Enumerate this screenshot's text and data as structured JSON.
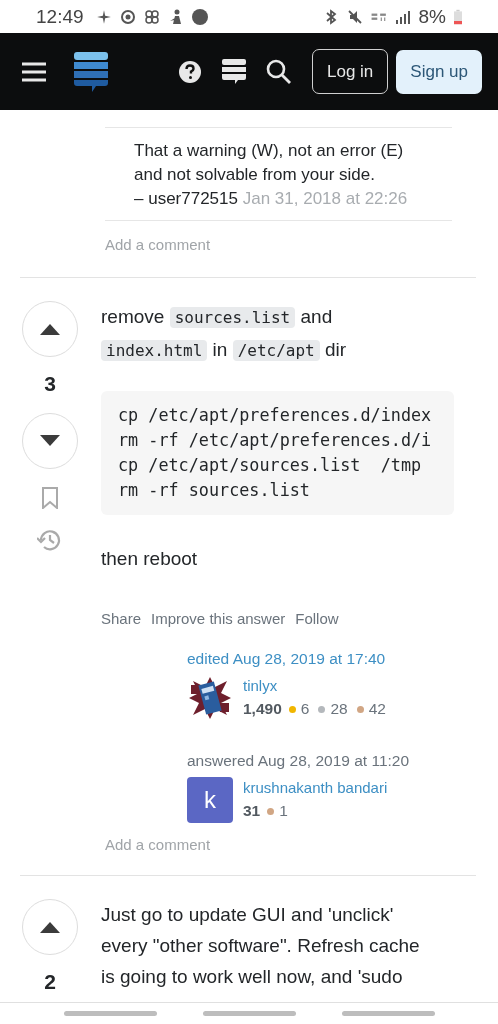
{
  "status_bar": {
    "time": "12:49",
    "battery": "8%"
  },
  "top_bar": {
    "buttons": [
      {
        "label": "Log in",
        "kind": "outline"
      },
      {
        "label": "Sign up",
        "kind": "filled"
      }
    ]
  },
  "comment": {
    "text": "That a warning (W), not an error (E) and not solvable from your side.",
    "author": "– user772515",
    "date": "Jan 31, 2018 at 22:26"
  },
  "add_comment_top": "Add a comment",
  "answer": {
    "votes": "3",
    "body": [
      {
        "kind": "text",
        "text": "remove "
      },
      {
        "kind": "code",
        "text": "sources.list"
      },
      {
        "kind": "text",
        "text": " and "
      },
      {
        "kind": "code",
        "text": "index.html"
      },
      {
        "kind": "text",
        "text": " in "
      },
      {
        "kind": "code",
        "text": "/etc/apt"
      },
      {
        "kind": "text",
        "text": " dir"
      }
    ],
    "code_lines": [
      "cp /etc/apt/preferences.d/index",
      "rm -rf /etc/apt/preferences.d/i",
      "cp /etc/apt/sources.list  /tmp",
      "rm -rf sources.list"
    ],
    "after": "then reboot",
    "actions": [
      "Share",
      "Improve this answer",
      "Follow"
    ],
    "edited": {
      "label": "edited Aug 28, 2019 at 17:40",
      "user": {
        "name": "tinlyx",
        "reputation": "1,490",
        "badges": [
          {
            "count": "6",
            "color": "#f1b600"
          },
          {
            "count": "28",
            "color": "#b4b8bc"
          },
          {
            "count": "42",
            "color": "#d1a684"
          }
        ]
      }
    },
    "answered": {
      "label": "answered Aug 28, 2019 at 11:20",
      "user": {
        "name": "krushnakanth bandari",
        "avatar": {
          "kind": "letter",
          "letter": "k",
          "color": "#5b67c4"
        },
        "reputation": "31",
        "badges": [
          {
            "count": "1",
            "color": "#d1a684"
          }
        ]
      }
    },
    "add_comment": "Add a comment"
  },
  "next_answer": {
    "votes": "2",
    "lines": [
      "Just go to update GUI and 'unclick'",
      "every \"other software\". Refresh cache",
      "is going to work well now, and 'sudo"
    ]
  }
}
